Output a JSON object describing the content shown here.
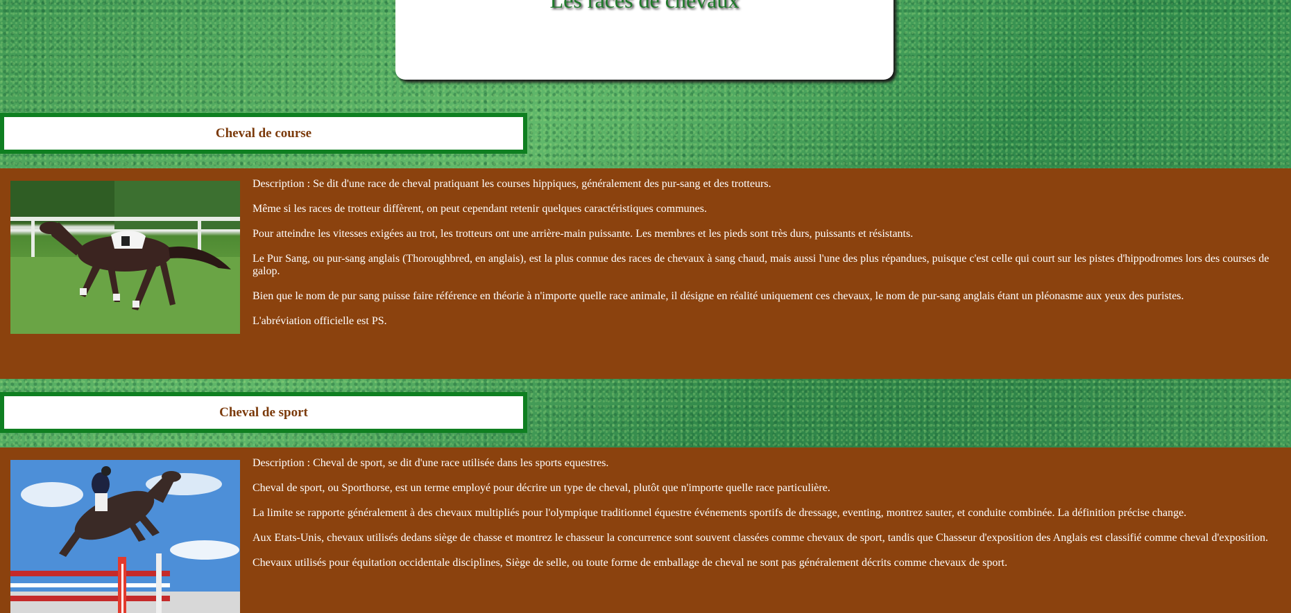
{
  "header": {
    "title": "Les races de chevaux"
  },
  "sections": [
    {
      "title": "Cheval de course",
      "image_alt": "Cheval de course au galop avec une selle blanche",
      "paragraphs": [
        "Description : Se dit d'une race de cheval pratiquant les courses hippiques, généralement des pur-sang et des trotteurs.",
        "Même si les races de trotteur diffèrent, on peut cependant retenir quelques caractéristiques communes.",
        "Pour atteindre les vitesses exigées au trot, les trotteurs ont une arrière-main puissante. Les membres et les pieds sont très durs, puissants et résistants.",
        "Le Pur Sang, ou pur-sang anglais (Thoroughbred, en anglais), est la plus connue des races de chevaux à sang chaud, mais aussi l'une des plus répandues, puisque c'est celle qui court sur les pistes d'hippodromes lors des courses de galop.",
        "Bien que le nom de pur sang puisse faire référence en théorie à n'importe quelle race animale, il désigne en réalité uniquement ces chevaux, le nom de pur-sang anglais étant un pléonasme aux yeux des puristes.",
        "L'abréviation officielle est PS."
      ]
    },
    {
      "title": "Cheval de sport",
      "image_alt": "Cavalier sautant un obstacle",
      "paragraphs": [
        "Description : Cheval de sport, se dit d'une race utilisée dans les sports equestres.",
        "Cheval de sport, ou Sporthorse, est un terme employé pour décrire un type de cheval, plutôt que n'importe quelle race particulière.",
        "La limite se rapporte généralement à des chevaux multipliés pour l'olympique traditionnel équestre événements sportifs de dressage, eventing, montrez sauter, et conduite combinée. La définition précise change.",
        "Aux Etats-Unis, chevaux utilisés dedans siège de chasse et montrez le chasseur la concurrence sont souvent classées comme chevaux de sport, tandis que Chasseur d'exposition des Anglais est classifié comme cheval d'exposition.",
        "Chevaux utilisés pour équitation occidentale disciplines, Siège de selle, ou toute forme de emballage de cheval ne sont pas généralement décrits comme chevaux de sport."
      ]
    }
  ]
}
